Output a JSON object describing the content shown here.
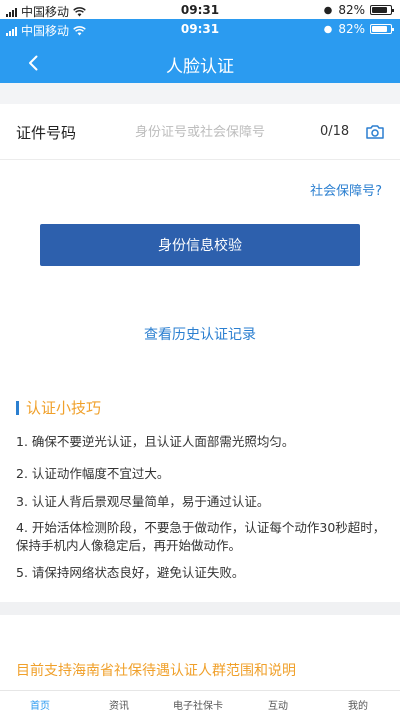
{
  "status_bar": {
    "carrier": "中国移动",
    "time": "09:31",
    "battery": "82%",
    "battery_level": 0.82
  },
  "navbar": {
    "title": "人脸认证"
  },
  "form": {
    "id_label": "证件号码",
    "id_placeholder": "身份证号或社会保障号",
    "id_value": "",
    "id_counter": "0/18",
    "ssn_link": "社会保障号?"
  },
  "actions": {
    "verify_button": "身份信息校验",
    "history_link": "查看历史认证记录"
  },
  "tips": {
    "title": "认证小技巧",
    "items": [
      "1. 确保不要逆光认证，且认证人面部需光照均匀。",
      "2. 认证动作幅度不宜过大。",
      "3. 认证人背后景观尽量简单，易于通过认证。",
      "4. 开始活体检测阶段，不要急于做动作，认证每个动作30秒超时，保持手机内人像稳定后，再开始做动作。",
      "5. 请保持网络状态良好，避免认证失败。"
    ]
  },
  "support_text": "目前支持海南省社保待遇认证人群范围和说明",
  "tabbar": {
    "items": [
      "首页",
      "资讯",
      "电子社保卡",
      "互动",
      "我的"
    ],
    "active": "首页"
  },
  "colors": {
    "primary": "#2b9bf0",
    "button": "#2d60ad",
    "link": "#2b7fd0",
    "accent": "#f0a02a"
  }
}
